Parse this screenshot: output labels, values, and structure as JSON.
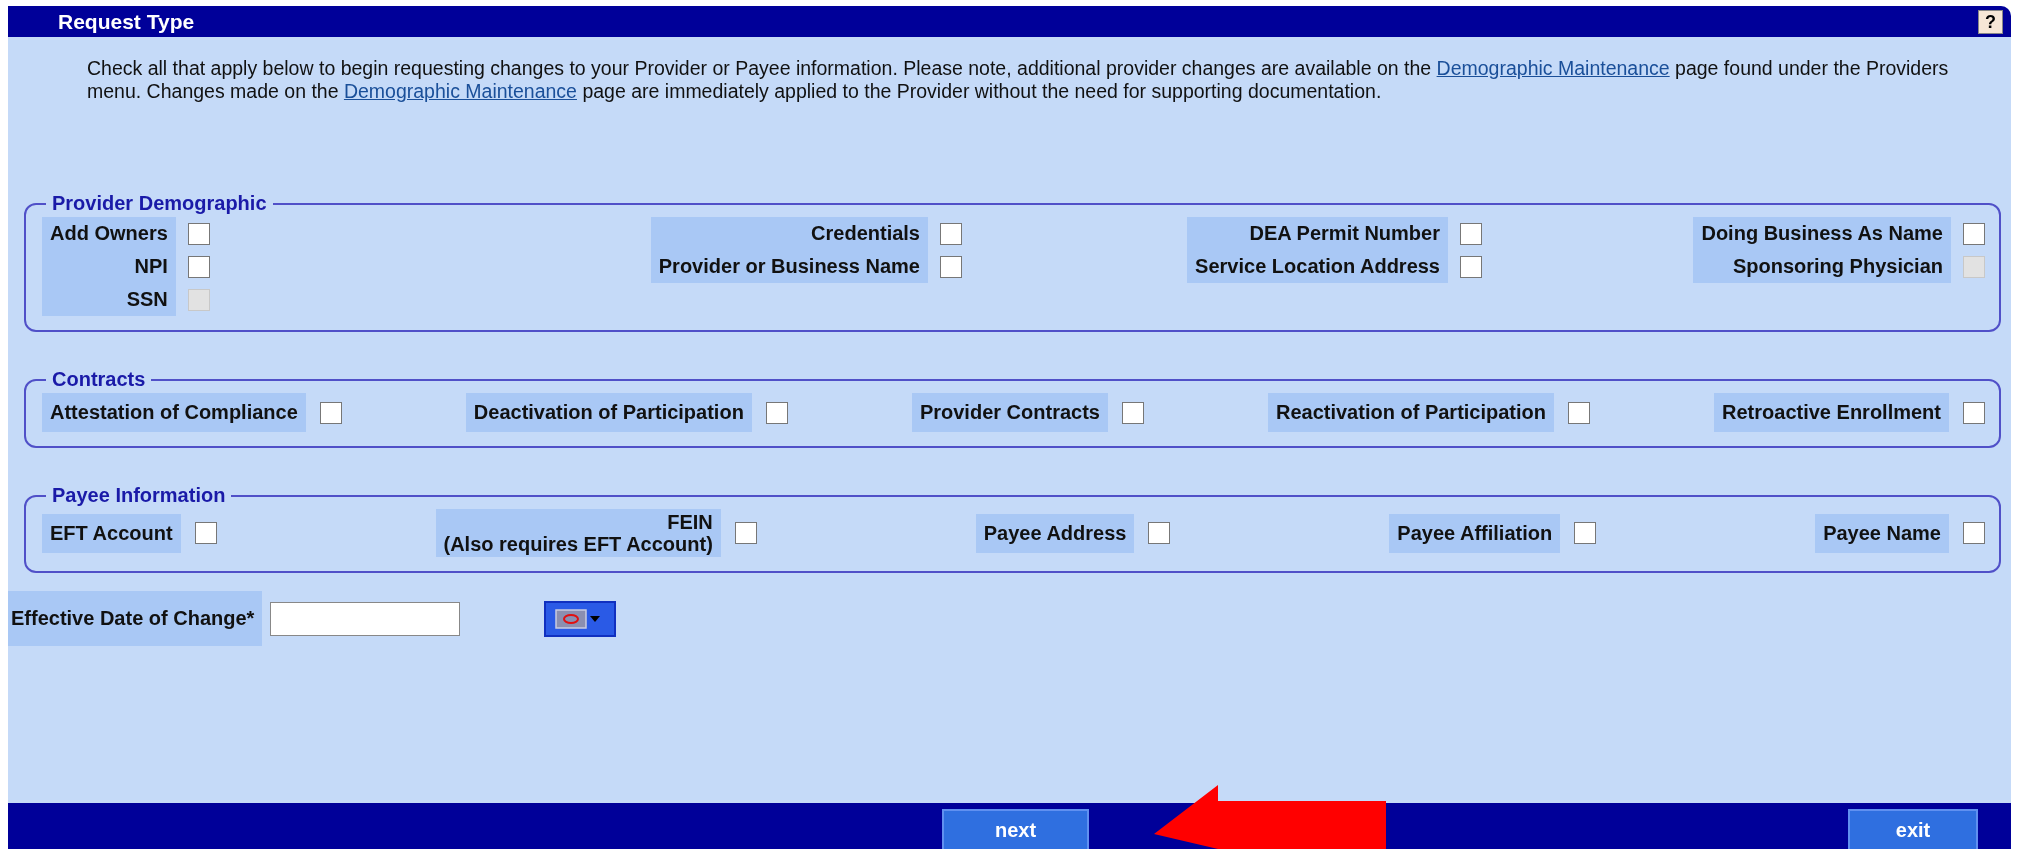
{
  "header": {
    "title": "Request Type",
    "help": "?"
  },
  "intro": [
    {
      "kind": "text",
      "text": "Check all that apply below to begin requesting changes to your Provider or Payee information. Please note, additional provider changes are available on the "
    },
    {
      "kind": "link",
      "text": "Demographic Maintenance"
    },
    {
      "kind": "text",
      "text": " page found under the Providers menu. Changes made on the "
    },
    {
      "kind": "link",
      "text": "Demographic Maintenance"
    },
    {
      "kind": "text",
      "text": " page are immediately applied to the Provider without the need for supporting documentation."
    }
  ],
  "provider_demographic": {
    "title": "Provider Demographic",
    "columns": [
      [
        {
          "label": "Add Owners",
          "checked": false,
          "disabled": false
        },
        {
          "label": "NPI",
          "checked": false,
          "disabled": false
        },
        {
          "label": "SSN",
          "checked": false,
          "disabled": true
        }
      ],
      [
        {
          "label": "Credentials",
          "checked": false,
          "disabled": false
        },
        {
          "label": "Provider or Business Name",
          "checked": false,
          "disabled": false
        }
      ],
      [
        {
          "label": "DEA Permit Number",
          "checked": false,
          "disabled": false
        },
        {
          "label": "Service Location Address",
          "checked": false,
          "disabled": false
        }
      ],
      [
        {
          "label": "Doing Business As Name",
          "checked": false,
          "disabled": false
        },
        {
          "label": "Sponsoring Physician",
          "checked": false,
          "disabled": true
        }
      ]
    ]
  },
  "contracts": {
    "title": "Contracts",
    "items": [
      {
        "label": "Attestation of Compliance",
        "checked": false,
        "disabled": false
      },
      {
        "label": "Deactivation of Participation",
        "checked": false,
        "disabled": false
      },
      {
        "label": "Provider Contracts",
        "checked": false,
        "disabled": false
      },
      {
        "label": "Reactivation of Participation",
        "checked": false,
        "disabled": false
      },
      {
        "label": "Retroactive Enrollment",
        "checked": false,
        "disabled": false
      }
    ]
  },
  "payee_information": {
    "title": "Payee Information",
    "items": [
      {
        "label": "EFT Account",
        "checked": false,
        "disabled": false
      },
      {
        "label": "FEIN",
        "note": "(Also requires EFT Account)",
        "checked": false,
        "disabled": false
      },
      {
        "label": "Payee Address",
        "checked": false,
        "disabled": false
      },
      {
        "label": "Payee Affiliation",
        "checked": false,
        "disabled": false
      },
      {
        "label": "Payee Name",
        "checked": false,
        "disabled": false
      }
    ]
  },
  "effective_date": {
    "label": "Effective Date of Change*"
  },
  "footer": {
    "buttons": [
      "next",
      "exit"
    ]
  }
}
